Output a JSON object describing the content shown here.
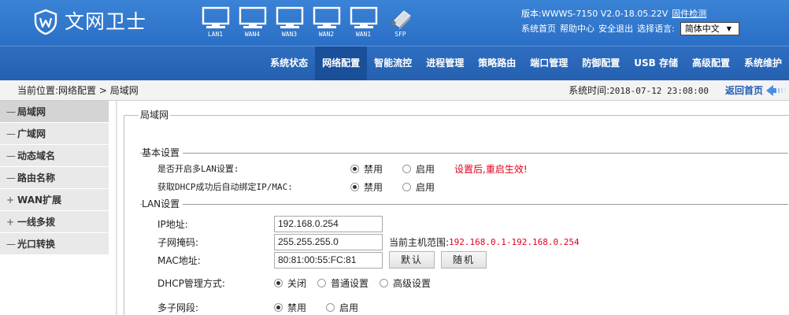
{
  "brand": {
    "name": "文网卫士"
  },
  "ports": [
    {
      "label": "LAN1",
      "type": "ethernet"
    },
    {
      "label": "WAN4",
      "type": "ethernet"
    },
    {
      "label": "WAN3",
      "type": "ethernet"
    },
    {
      "label": "WAN2",
      "type": "ethernet"
    },
    {
      "label": "WAN1",
      "type": "ethernet"
    },
    {
      "label": "SFP",
      "type": "sfp"
    }
  ],
  "header": {
    "version": "版本:WWWS-7150 V2.0-18.05.22V",
    "firmware_check": "固件检测",
    "links": [
      "系统首页",
      "帮助中心",
      "安全退出",
      "选择语言:"
    ],
    "language": "简体中文"
  },
  "nav": {
    "items": [
      "系统状态",
      "网络配置",
      "智能流控",
      "进程管理",
      "策略路由",
      "端口管理",
      "防御配置",
      "USB 存储",
      "高级配置",
      "系统维护"
    ],
    "active_index": 1
  },
  "crumb": {
    "text": "当前位置:网络配置 > 局域网",
    "systime_label": "系统时间:",
    "systime_value": "2018-07-12 23:08:00",
    "home": "返回首页"
  },
  "sidebar": {
    "items": [
      {
        "mark": "—",
        "label": "局域网"
      },
      {
        "mark": "—",
        "label": "广域网"
      },
      {
        "mark": "—",
        "label": "动态域名"
      },
      {
        "mark": "—",
        "label": "路由名称"
      },
      {
        "mark": "+",
        "label": "WAN扩展"
      },
      {
        "mark": "+",
        "label": "一线多拨"
      },
      {
        "mark": "—",
        "label": "光口转换"
      }
    ],
    "active_index": 0
  },
  "panel": {
    "legend": "局域网",
    "basic": {
      "title": "基本设置",
      "multi_lan_label": "是否开启多LAN设置:",
      "dhcp_bind_label": "获取DHCP成功后自动绑定IP/MAC:",
      "disable": "禁用",
      "enable": "启用",
      "restart_note": "设置后,重启生效!"
    },
    "lan": {
      "title": "LAN设置",
      "ip_label": "IP地址:",
      "ip_value": "192.168.0.254",
      "mask_label": "子网掩码:",
      "mask_value": "255.255.255.0",
      "range_label": "当前主机范围:",
      "range_value": "192.168.0.1-192.168.0.254",
      "mac_label": "MAC地址:",
      "mac_value": "80:81:00:55:FC:81",
      "default_btn": "默认",
      "random_btn": "随机",
      "dhcp_mode_label": "DHCP管理方式:",
      "dhcp_off": "关闭",
      "dhcp_normal": "普通设置",
      "dhcp_advanced": "高级设置",
      "subnet_label": "多子网段:",
      "disable": "禁用",
      "enable": "启用"
    }
  }
}
